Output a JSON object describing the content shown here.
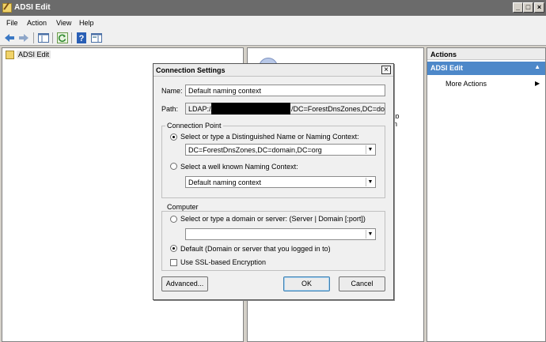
{
  "window": {
    "title": "ADSI Edit"
  },
  "menu": [
    "File",
    "Action",
    "View",
    "Help"
  ],
  "tree": {
    "root_label": "ADSI Edit"
  },
  "center": {
    "fragment1": "to",
    "fragment2": "n"
  },
  "actions": {
    "header": "Actions",
    "section": "ADSI Edit",
    "items": [
      "More Actions"
    ]
  },
  "dialog": {
    "title": "Connection Settings",
    "name_label": "Name:",
    "name_value": "Default naming context",
    "path_label": "Path:",
    "path_prefix": "LDAP://",
    "path_suffix": "/DC=ForestDnsZones,DC=dom",
    "connection_point": {
      "legend": "Connection Point",
      "option1_label": "Select or type a Distinguished Name or Naming Context:",
      "option1_value": "DC=ForestDnsZones,DC=domain,DC=org",
      "option2_label": "Select a well known Naming Context:",
      "option2_value": "Default naming context",
      "selected": "option1"
    },
    "computer": {
      "legend": "Computer",
      "option1_label": "Select or type a domain or server: (Server | Domain [:port])",
      "option1_value": "",
      "option2_label": "Default (Domain or server that you logged in to)",
      "selected": "option2",
      "ssl_label": "Use SSL-based Encryption",
      "ssl_checked": false
    },
    "buttons": {
      "advanced": "Advanced...",
      "ok": "OK",
      "cancel": "Cancel"
    }
  }
}
